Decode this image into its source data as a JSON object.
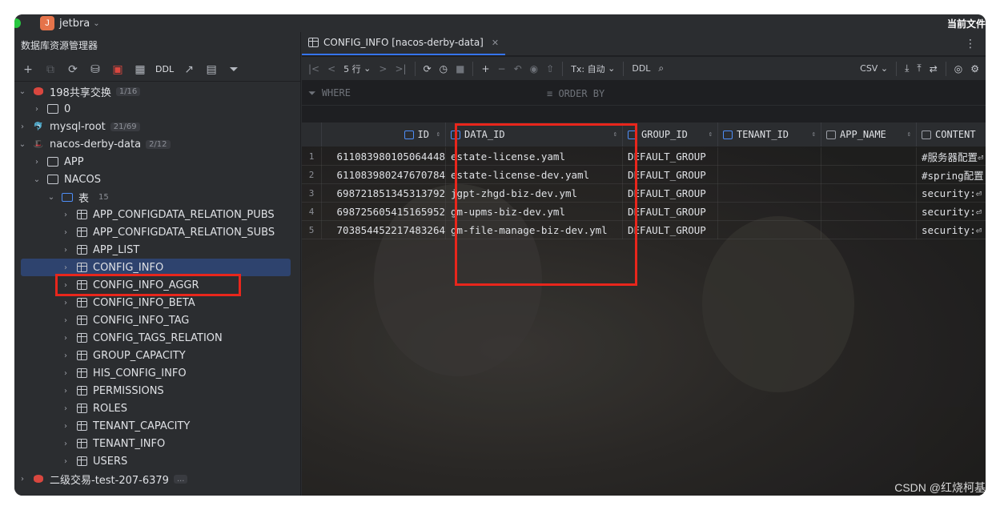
{
  "titlebar": {
    "project_badge": "J",
    "project_name": "jetbra",
    "right_text": "当前文件"
  },
  "left_panel": {
    "title": "数据库资源管理器",
    "toolbar": {
      "ddl_label": "DDL"
    },
    "tree": [
      {
        "label": "198共享交换",
        "count": "1/16",
        "expanded": true,
        "level": 0,
        "icon": "database-red-icon"
      },
      {
        "label": "0",
        "level": 1,
        "icon": "schema-icon"
      },
      {
        "label": "mysql-root",
        "count": "21/69",
        "level": 0,
        "icon": "mysql-icon"
      },
      {
        "label": "nacos-derby-data",
        "count": "2/12",
        "expanded": true,
        "level": 0,
        "icon": "derby-icon"
      },
      {
        "label": "APP",
        "level": 1,
        "icon": "schema-icon"
      },
      {
        "label": "NACOS",
        "expanded": true,
        "level": 1,
        "icon": "schema-icon"
      },
      {
        "label": "表",
        "count": "15",
        "expanded": true,
        "level": 2,
        "icon": "folder-icon"
      },
      {
        "label": "APP_CONFIGDATA_RELATION_PUBS",
        "level": 3,
        "icon": "table-icon"
      },
      {
        "label": "APP_CONFIGDATA_RELATION_SUBS",
        "level": 3,
        "icon": "table-icon"
      },
      {
        "label": "APP_LIST",
        "level": 3,
        "icon": "table-icon"
      },
      {
        "label": "CONFIG_INFO",
        "level": 3,
        "icon": "table-icon",
        "selected": true
      },
      {
        "label": "CONFIG_INFO_AGGR",
        "level": 3,
        "icon": "table-icon"
      },
      {
        "label": "CONFIG_INFO_BETA",
        "level": 3,
        "icon": "table-icon"
      },
      {
        "label": "CONFIG_INFO_TAG",
        "level": 3,
        "icon": "table-icon"
      },
      {
        "label": "CONFIG_TAGS_RELATION",
        "level": 3,
        "icon": "table-icon"
      },
      {
        "label": "GROUP_CAPACITY",
        "level": 3,
        "icon": "table-icon"
      },
      {
        "label": "HIS_CONFIG_INFO",
        "level": 3,
        "icon": "table-icon"
      },
      {
        "label": "PERMISSIONS",
        "level": 3,
        "icon": "table-icon"
      },
      {
        "label": "ROLES",
        "level": 3,
        "icon": "table-icon"
      },
      {
        "label": "TENANT_CAPACITY",
        "level": 3,
        "icon": "table-icon"
      },
      {
        "label": "TENANT_INFO",
        "level": 3,
        "icon": "table-icon"
      },
      {
        "label": "USERS",
        "level": 3,
        "icon": "table-icon"
      },
      {
        "label": "二级交易-test-207-6379",
        "count": "...",
        "level": 0,
        "icon": "database-red-icon"
      }
    ]
  },
  "editor": {
    "tab_label": "CONFIG_INFO [nacos-derby-data]",
    "toolbar": {
      "rows_label": "5 行",
      "tx_label": "Tx: 自动",
      "ddl_label": "DDL",
      "export_format": "CSV"
    },
    "filter": {
      "where_placeholder": "WHERE",
      "order_placeholder": "ORDER BY"
    },
    "columns": [
      "ID",
      "DATA_ID",
      "GROUP_ID",
      "TENANT_ID",
      "APP_NAME",
      "CONTENT"
    ],
    "rows": [
      {
        "n": "1",
        "id": "611083980105064448",
        "data_id": "estate-license.yaml",
        "group_id": "DEFAULT_GROUP",
        "tenant_id": "",
        "app_name": "",
        "content": "#服务器配置⏎"
      },
      {
        "n": "2",
        "id": "611083980247670784",
        "data_id": "estate-license-dev.yaml",
        "group_id": "DEFAULT_GROUP",
        "tenant_id": "",
        "app_name": "",
        "content": "#spring配置"
      },
      {
        "n": "3",
        "id": "698721851345313792",
        "data_id": "jgpt-zhgd-biz-dev.yml",
        "group_id": "DEFAULT_GROUP",
        "tenant_id": "",
        "app_name": "",
        "content": "security:⏎"
      },
      {
        "n": "4",
        "id": "698725605415165952",
        "data_id": "gm-upms-biz-dev.yml",
        "group_id": "DEFAULT_GROUP",
        "tenant_id": "",
        "app_name": "",
        "content": "security:⏎"
      },
      {
        "n": "5",
        "id": "703854452217483264",
        "data_id": "gm-file-manage-biz-dev.yml",
        "group_id": "DEFAULT_GROUP",
        "tenant_id": "",
        "app_name": "",
        "content": "security:⏎"
      }
    ]
  },
  "watermark": "CSDN @红烧柯基",
  "colors": {
    "accent": "#3574f0",
    "highlight_box": "#e8261c",
    "selection": "#2e436e"
  }
}
